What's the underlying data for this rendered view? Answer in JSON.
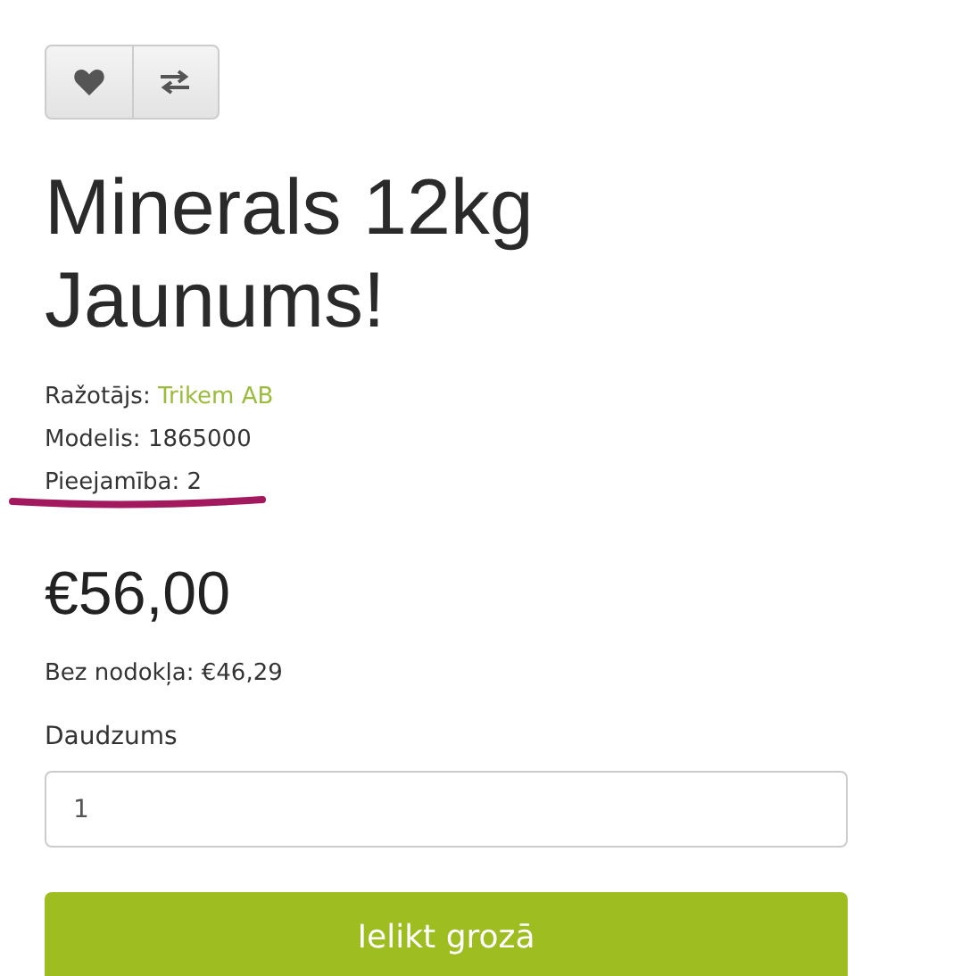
{
  "actions": [
    {
      "kind": "wishlist"
    },
    {
      "kind": "compare"
    }
  ],
  "title": "Minerals 12kg Jaunums!",
  "details": [
    {
      "label": "Ražotājs:",
      "value": "Trikem AB",
      "kind": "link"
    },
    {
      "label": "Modelis:",
      "value": "1865000",
      "kind": "text"
    },
    {
      "label": "Pieejamība:",
      "value": "2",
      "kind": "text",
      "underlined": true
    }
  ],
  "price": "€56,00",
  "tax_note": "Bez nodokļa: €46,29",
  "quantity": {
    "label": "Daudzums",
    "value": "1"
  },
  "cart_button": "Ielikt grozā"
}
